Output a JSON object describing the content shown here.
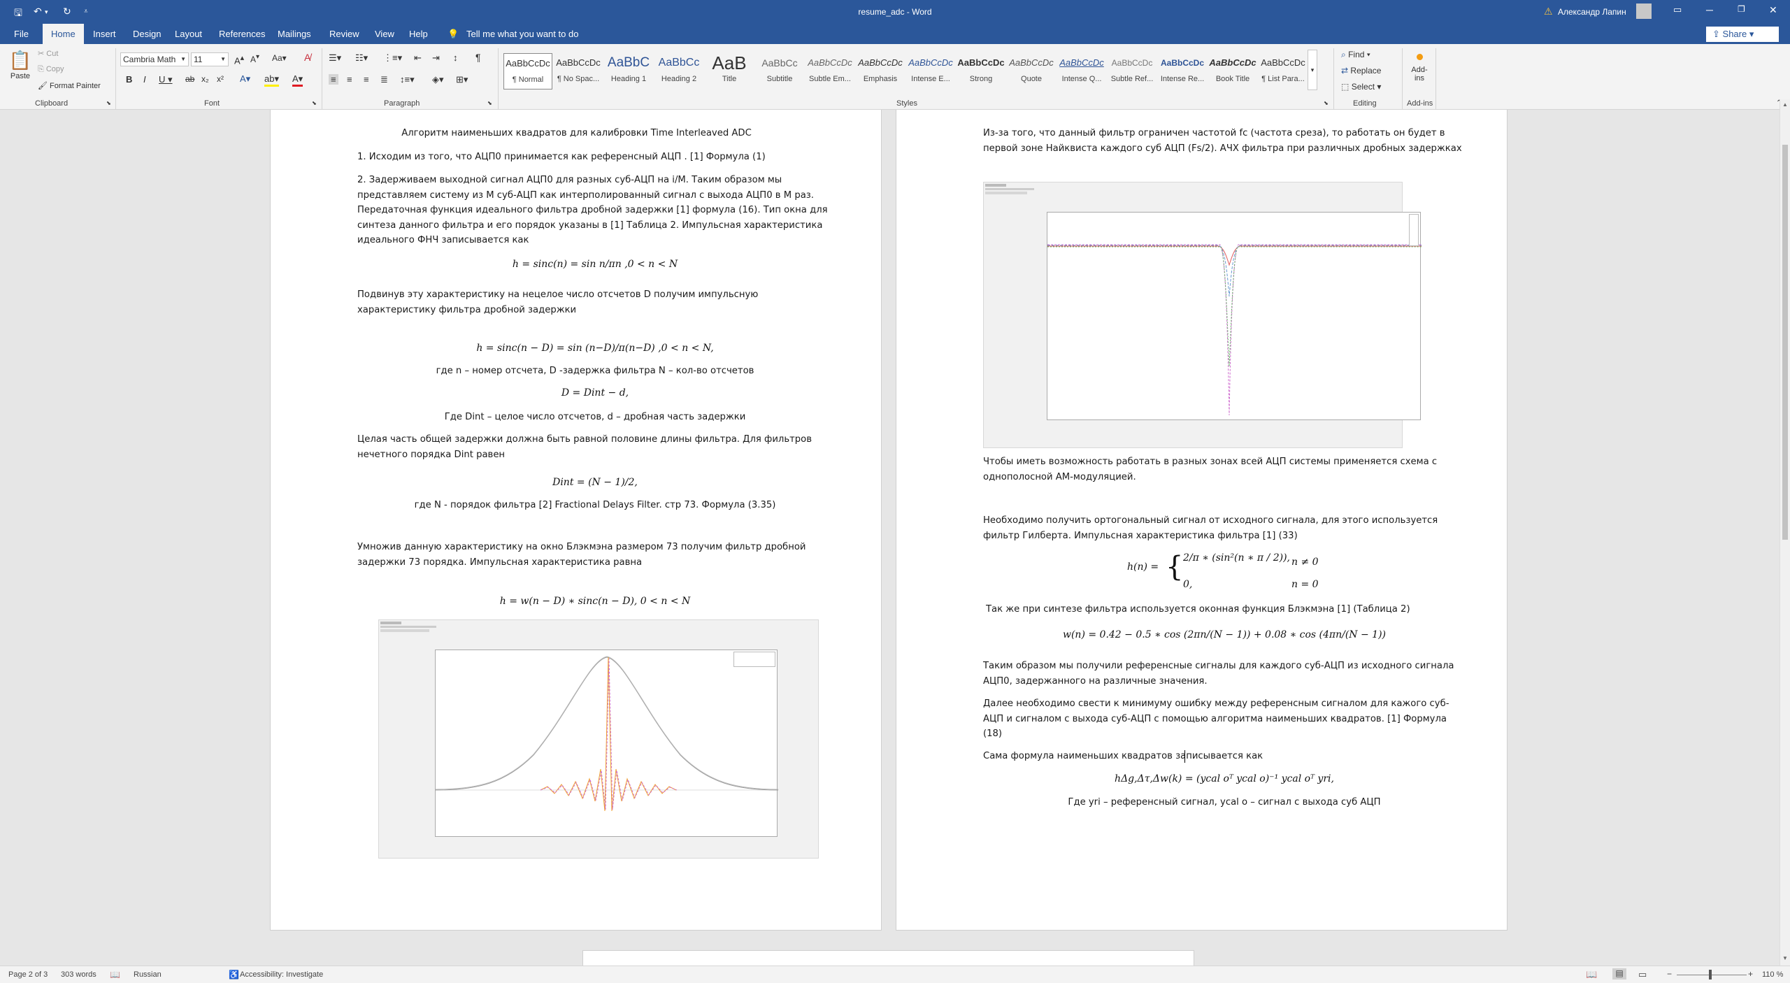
{
  "titlebar": {
    "title": "resume_adc  -  Word",
    "user": "Александр Лапин",
    "share": "Share"
  },
  "tabs": [
    "File",
    "Home",
    "Insert",
    "Design",
    "Layout",
    "References",
    "Mailings",
    "Review",
    "View",
    "Help"
  ],
  "tell_me": "Tell me what you want to do",
  "clipboard": {
    "paste": "Paste",
    "cut": "Cut",
    "copy": "Copy",
    "format_painter": "Format Painter",
    "group": "Clipboard"
  },
  "font": {
    "name": "Cambria Math",
    "size": "11",
    "group": "Font"
  },
  "paragraph_group": "Paragraph",
  "styles": [
    {
      "preview": "AaBbCcDc",
      "name": "¶ Normal"
    },
    {
      "preview": "AaBbCcDc",
      "name": "¶ No Spac..."
    },
    {
      "preview": "AaBbC",
      "name": "Heading 1"
    },
    {
      "preview": "AaBbCc",
      "name": "Heading 2"
    },
    {
      "preview": "AaB",
      "name": "Title"
    },
    {
      "preview": "AaBbCc",
      "name": "Subtitle"
    },
    {
      "preview": "AaBbCcDc",
      "name": "Subtle Em..."
    },
    {
      "preview": "AaBbCcDc",
      "name": "Emphasis"
    },
    {
      "preview": "AaBbCcDc",
      "name": "Intense E..."
    },
    {
      "preview": "AaBbCcDc",
      "name": "Strong"
    },
    {
      "preview": "AaBbCcDc",
      "name": "Quote"
    },
    {
      "preview": "AaBbCcDc",
      "name": "Intense Q..."
    },
    {
      "preview": "AaBbCcDc",
      "name": "Subtle Ref..."
    },
    {
      "preview": "AaBbCcDc",
      "name": "Intense Re..."
    },
    {
      "preview": "AaBbCcDc",
      "name": "Book Title"
    },
    {
      "preview": "AaBbCcDc",
      "name": "¶ List Para..."
    }
  ],
  "styles_group": "Styles",
  "editing": {
    "find": "Find",
    "replace": "Replace",
    "select": "Select",
    "group": "Editing"
  },
  "addins": {
    "label": "Add-ins",
    "group": "Add-ins"
  },
  "page_left": {
    "title": "Алгоритм наименьших квадратов для калибровки Time Interleaved ADC",
    "p1": "1. Исходим из того, что АЦП0 принимается как референсный АЦП . [1] Формула (1)",
    "p2": "2. Задерживаем выходной сигнал АЦП0 для разных суб-АЦП на i/M. Таким образом мы представляем систему из M суб-АЦП как интерполированный сигнал с выхода АЦП0 в M раз. Передаточная функция идеального фильтра дробной задержки [1] формула (16). Тип окна для синтеза данного фильтра и его порядок указаны в [1] Таблица 2. Импульсная характеристика идеального ФНЧ записывается как",
    "eq1": "h = sinc(n) = sin n/πn ,0 < n <  N",
    "p3": "Подвинув эту характеристику на нецелое число отсчетов D получим импульсную характеристику фильтра дробной задержки",
    "eq2": "h = sinc(n − D) = sin (n−D)/π(n−D) ,0 < n <  N,",
    "p4": "где n – номер отсчета, D -задержка фильтра N – кол-во отсчетов",
    "eq3": "D = Dint − d,",
    "p5": "Где Dint – целое число отсчетов, d – дробная часть задержки",
    "p6": "Целая часть общей задержки должна быть равной половине длины фильтра. Для фильтров нечетного порядка Dint равен",
    "eq4": "Dint = (N − 1)/2,",
    "p7": "где N - порядок фильтра [2] Fractional Delays Filter. стр 73. Формула (3.35)",
    "p8": "Умножив данную характеристику на окно Блэкмэна размером 73 получим фильтр дробной задержки 73 порядка. Импульсная характеристика равна",
    "eq5": "h = w(n − D) ∗ sinc(n − D), 0 < n <  N"
  },
  "page_right": {
    "p1": "Из-за того, что данный фильтр ограничен частотой fc (частота среза), то работать он будет в первой зоне Найквиста каждого суб АЦП (Fs/2). АЧХ фильтра при различных дробных задержках",
    "p2": "Чтобы иметь возможность работать в разных зонах всей АЦП системы применяется схема с однополосной АМ-модуляцией.",
    "p3": "Необходимо получить ортогональный сигнал от исходного сигнала, для этого используется фильтр Гилберта. Импульсная характеристика фильтра [1] (33)",
    "eq1a": "h(n) =",
    "eq1b": "2/π ∗ (sin²(n ∗ π / 2)),",
    "eq1c": "n ≠ 0",
    "eq1d": "0,",
    "eq1e": "n = 0",
    "p4": "Так же при синтезе фильтра используется оконная функция Блэкмэна [1] (Таблица 2)",
    "eq2": "w(n) = 0.42 − 0.5 ∗ cos (2πn/(N − 1)) + 0.08 ∗ cos (4πn/(N − 1))",
    "p5": "Таким образом мы получили референсные сигналы для каждого суб-АЦП из исходного сигнала  АЦП0, задержанного на различные значения.",
    "p6": "Далее необходимо свести к минимуму ошибку между референсным сигналом для кажого суб-АЦП и сигналом с выхода суб-АЦП с помощью алгоритма наименьших квадратов. [1] Формула (18)",
    "p7": "Сама формула наименьших квадратов записывается как",
    "eq3": "hΔg,Δτ,Δw(k) = (ycal oᵀ ycal o)⁻¹ ycal oᵀ yri,",
    "p8": "Где yri – референсный сигнал, ycal o – сигнал с выхода суб АЦП"
  },
  "status": {
    "page": "Page 2 of 3",
    "words": "303 words",
    "language": "Russian",
    "accessibility": "Accessibility: Investigate",
    "zoom": "110 %"
  }
}
